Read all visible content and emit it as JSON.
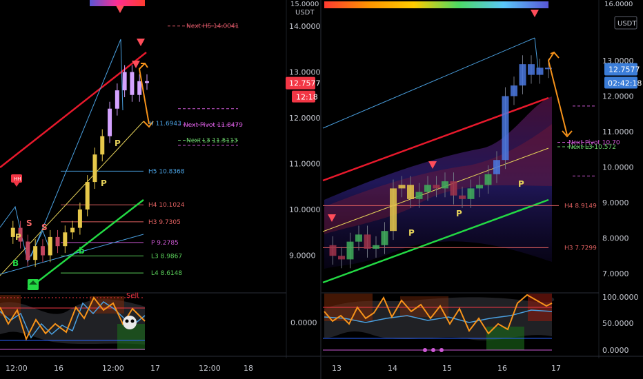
{
  "left_panel": {
    "currency": "USDT",
    "top_label": "15.0000",
    "price_ticks": [
      "14.0000",
      "13.0000",
      "12.0000",
      "11.0000",
      "10.0000",
      "9.0000"
    ],
    "current_price": "12.7577",
    "countdown": "12:18",
    "osc_tick": "0.0000",
    "time_ticks": [
      "12:00",
      "16",
      "12:00",
      "17",
      "12:00",
      "18"
    ],
    "levels": [
      {
        "label": "Next H5 14.0041",
        "price": 14.0041,
        "color": "#e05a6a"
      },
      {
        "label": "Next Pivot 11.8479",
        "price": 11.8479,
        "color": "#d05ad8"
      },
      {
        "label": "Next L3 11.5113",
        "price": 11.5113,
        "color": "#6ad06a"
      },
      {
        "label": "H5 10.8368",
        "price": 10.8368,
        "color": "#4aa0e0"
      },
      {
        "label": "H4 10.1024",
        "price": 10.1024,
        "color": "#e06060"
      },
      {
        "label": "H3 9.7305",
        "price": 9.7305,
        "color": "#e06060"
      },
      {
        "label": "P 9.2785",
        "price": 9.2785,
        "color": "#d05ad8"
      },
      {
        "label": "L3 8.9867",
        "price": 8.9867,
        "color": "#5ad05a"
      },
      {
        "label": "L4 8.6148",
        "price": 8.6148,
        "color": "#5ad05a"
      }
    ],
    "arrow_label": "H 11.6943",
    "markers": [
      "HH",
      "S",
      "S",
      "P",
      "P",
      "P",
      "B",
      "b",
      "Sell"
    ]
  },
  "right_panel": {
    "currency": "USDT",
    "top_label": "16.0000",
    "price_ticks": [
      "13.0000",
      "12.0000",
      "11.0000",
      "10.0000",
      "9.0000",
      "8.0000",
      "7.0000"
    ],
    "current_price": "12.7577",
    "countdown": "02:42:18",
    "osc_ticks": [
      "100.0000",
      "50.0000",
      "0.0000"
    ],
    "time_ticks": [
      "13",
      "14",
      "15",
      "16",
      "17"
    ],
    "levels": [
      {
        "label": "Next Pivot 10.70",
        "price": 10.7,
        "color": "#d05ad8"
      },
      {
        "label": "Next L3 10.572",
        "price": 10.572,
        "color": "#6ad06a"
      },
      {
        "label": "H4 8.9149",
        "price": 8.9149,
        "color": "#e06060"
      },
      {
        "label": "H3 7.7299",
        "price": 7.7299,
        "color": "#e06060"
      }
    ],
    "markers": [
      "P",
      "P",
      "P",
      "P"
    ]
  },
  "colors": {
    "background": "#000000",
    "up": "#26a69a",
    "down": "#ef5350",
    "price_badge": "#f23645",
    "price_badge_blue": "#2962ff",
    "arrow": "#f7931a",
    "support": "#23d944",
    "resistance": "#e8192c"
  },
  "chart_data": [
    {
      "type": "line",
      "title": "",
      "x_axis": [
        "12:00",
        "16",
        "12:00",
        "17",
        "12:00",
        "18"
      ],
      "ylim": [
        8.4,
        15.0
      ],
      "current_price": 12.7577,
      "pivot_levels": [
        {
          "name": "Next H5",
          "value": 14.0041
        },
        {
          "name": "Next Pivot",
          "value": 11.8479
        },
        {
          "name": "Next L3",
          "value": 11.5113
        },
        {
          "name": "H5",
          "value": 10.8368
        },
        {
          "name": "H4",
          "value": 10.1024
        },
        {
          "name": "H3",
          "value": 9.7305
        },
        {
          "name": "P",
          "value": 9.2785
        },
        {
          "name": "L3",
          "value": 8.9867
        },
        {
          "name": "L4",
          "value": 8.6148
        }
      ],
      "price_path": [
        9.4,
        9.6,
        9.3,
        8.9,
        9.2,
        9.0,
        9.4,
        9.2,
        9.5,
        9.6,
        10.0,
        10.6,
        11.2,
        11.6,
        12.2,
        12.6,
        13.0,
        12.5,
        12.8,
        12.76
      ]
    },
    {
      "type": "line",
      "title": "",
      "x_axis": [
        "13",
        "14",
        "15",
        "16",
        "17"
      ],
      "ylim": [
        6.6,
        13.8
      ],
      "current_price": 12.7577,
      "pivot_levels": [
        {
          "name": "Next Pivot",
          "value": 10.7
        },
        {
          "name": "Next L3",
          "value": 10.572
        },
        {
          "name": "H4",
          "value": 8.9149
        },
        {
          "name": "H3",
          "value": 7.7299
        }
      ],
      "price_path": [
        7.8,
        7.5,
        7.4,
        7.9,
        8.1,
        7.7,
        7.8,
        8.2,
        9.4,
        9.5,
        9.1,
        9.3,
        9.5,
        9.4,
        9.6,
        9.2,
        9.1,
        9.4,
        9.5,
        9.8,
        10.2,
        12.0,
        12.3,
        12.9,
        12.6,
        12.8,
        12.76
      ]
    }
  ]
}
